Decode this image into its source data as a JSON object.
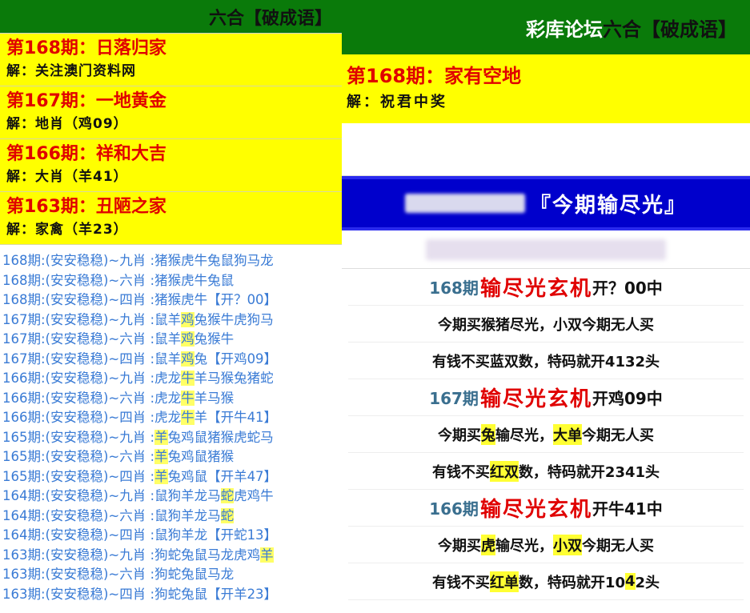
{
  "left": {
    "header_title": "六合【破成语】",
    "guesses": [
      {
        "title": "第168期：日落归家",
        "sub": "解：关注澳门资料网"
      },
      {
        "title": "第167期：一地黄金",
        "sub": "解：地肖（鸡09）"
      },
      {
        "title": "第166期：祥和大吉",
        "sub": "解：大肖（羊41）"
      },
      {
        "title": "第163期：丑陋之家",
        "sub": "解：家禽（羊23）"
      }
    ],
    "rows": [
      {
        "prefix": "168期:(安安稳稳)~九肖 :",
        "pre": "猪猴虎牛兔鼠狗马龙",
        "hl": "",
        "post": ""
      },
      {
        "prefix": "168期:(安安稳稳)~六肖 :",
        "pre": "猪猴虎牛兔鼠",
        "hl": "",
        "post": ""
      },
      {
        "prefix": "168期:(安安稳稳)~四肖 :",
        "pre": "猪猴虎牛【开？00】",
        "hl": "",
        "post": ""
      },
      {
        "prefix": "167期:(安安稳稳)~九肖 :",
        "pre": "鼠羊",
        "hl": "鸡",
        "post": "兔猴牛虎狗马"
      },
      {
        "prefix": "167期:(安安稳稳)~六肖 :",
        "pre": "鼠羊",
        "hl": "鸡",
        "post": "兔猴牛"
      },
      {
        "prefix": "167期:(安安稳稳)~四肖 :",
        "pre": "鼠羊",
        "hl": "鸡",
        "post": "兔【开鸡09】"
      },
      {
        "prefix": "166期:(安安稳稳)~九肖 :",
        "pre": "虎龙",
        "hl": "牛",
        "post": "羊马猴兔猪蛇"
      },
      {
        "prefix": "166期:(安安稳稳)~六肖 :",
        "pre": "虎龙",
        "hl": "牛",
        "post": "羊马猴"
      },
      {
        "prefix": "166期:(安安稳稳)~四肖 :",
        "pre": "虎龙",
        "hl": "牛",
        "post": "羊【开牛41】"
      },
      {
        "prefix": "165期:(安安稳稳)~九肖 :",
        "pre": "",
        "hl": "羊",
        "post": "兔鸡鼠猪猴虎蛇马"
      },
      {
        "prefix": "165期:(安安稳稳)~六肖 :",
        "pre": "",
        "hl": "羊",
        "post": "兔鸡鼠猪猴"
      },
      {
        "prefix": "165期:(安安稳稳)~四肖 :",
        "pre": "",
        "hl": "羊",
        "post": "兔鸡鼠【开羊47】"
      },
      {
        "prefix": "164期:(安安稳稳)~九肖 :",
        "pre": "鼠狗羊龙马",
        "hl": "蛇",
        "post": "虎鸡牛"
      },
      {
        "prefix": "164期:(安安稳稳)~六肖 :",
        "pre": "鼠狗羊龙马",
        "hl": "蛇",
        "post": ""
      },
      {
        "prefix": "164期:(安安稳稳)~四肖 :",
        "pre": "鼠狗羊龙【开蛇13】",
        "hl": "",
        "post": ""
      },
      {
        "prefix": "163期:(安安稳稳)~九肖 :",
        "pre": "狗蛇兔鼠马龙虎鸡",
        "hl": "羊",
        "post": ""
      },
      {
        "prefix": "163期:(安安稳稳)~六肖 :",
        "pre": "狗蛇兔鼠马龙",
        "hl": "",
        "post": ""
      },
      {
        "prefix": "163期:(安安稳稳)~四肖 :",
        "pre": "狗蛇兔鼠【开羊23】",
        "hl": "",
        "post": ""
      }
    ]
  },
  "right": {
    "header_prefix": "彩库论坛",
    "header_suffix": "六合【破成语】",
    "guess_title": "第168期：家有空地",
    "guess_sub": "解：祝君中奖",
    "banner": "『今期输尽光』",
    "rounds": [
      {
        "period": "168期",
        "mystic": "输尽光玄机",
        "result": "开？00中",
        "line1": {
          "a": "今期买猴猪尽光，小双今期无人买",
          "hl": ""
        },
        "line2": {
          "a": "有钱不买蓝双数，特码就开4132头"
        }
      },
      {
        "period": "167期",
        "mystic": "输尽光玄机",
        "result": "开鸡09中",
        "line1": {
          "pre": "今期买",
          "hl1": "兔",
          "mid": "输尽光，",
          "hl2": "大单",
          "post": "今期无人买"
        },
        "line2": {
          "pre": "有钱不买",
          "hl": "红双",
          "post": "数，特码就开2341头"
        }
      },
      {
        "period": "166期",
        "mystic": "输尽光玄机",
        "result": "开牛41中",
        "line1": {
          "pre": "今期买",
          "hl1": "虎",
          "mid": "输尽光，",
          "hl2": "小双",
          "post": "今期无人买"
        },
        "line2": {
          "pre": "有钱不买",
          "hl": "红单",
          "post": "数，特码就开10",
          "hl2": "4",
          "post2": "2头"
        }
      }
    ]
  }
}
